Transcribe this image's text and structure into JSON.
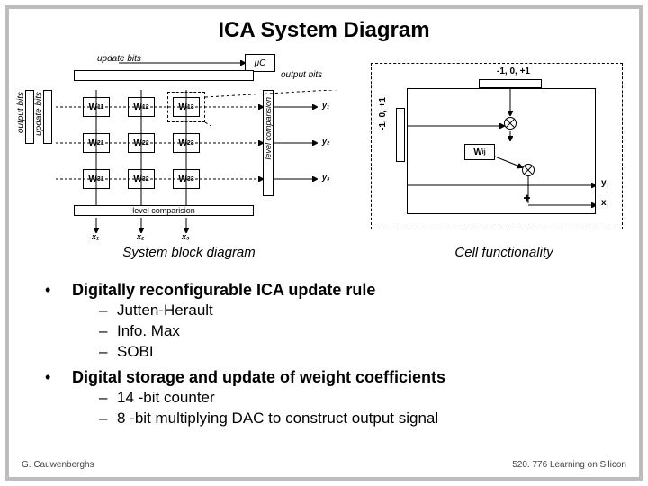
{
  "title": "ICA System Diagram",
  "left": {
    "update_bits_top": "update bits",
    "output_bits_top": "output bits",
    "mu_c": "μC",
    "output_bits_v": "output bits",
    "update_bits_v": "update bits",
    "level_comp_v": "level comparision",
    "level_comp_h": "level comparision",
    "w11": "W",
    "w11s": "11",
    "w12": "W",
    "w12s": "12",
    "w13": "W",
    "w13s": "13",
    "w21": "W",
    "w21s": "21",
    "w22": "W",
    "w22s": "22",
    "w23": "W",
    "w23s": "23",
    "w31": "W",
    "w31s": "31",
    "w32": "W",
    "w32s": "32",
    "w33": "W",
    "w33s": "33",
    "x1": "x₁",
    "x2": "x₂",
    "x3": "x₃",
    "y1": "y₁",
    "y2": "y₂",
    "y3": "y₃"
  },
  "right": {
    "t_top": "-1, 0, +1",
    "t_left": "-1, 0, +1",
    "wij": "W",
    "wijs": "ij",
    "yi": "y",
    "yis": "i",
    "xi": "x",
    "xis": "i"
  },
  "captions": {
    "left": "System block diagram",
    "right": "Cell functionality"
  },
  "bullets": {
    "b1": "Digitally reconfigurable ICA update rule",
    "b1s1": "Jutten-Herault",
    "b1s2": "Info. Max",
    "b1s3": "SOBI",
    "b2": "Digital storage and update of weight coefficients",
    "b2s1": "14 -bit counter",
    "b2s2": "8 -bit multiplying DAC to construct output signal"
  },
  "footer": {
    "left": "G. Cauwenberghs",
    "right": "520. 776 Learning on Silicon"
  }
}
